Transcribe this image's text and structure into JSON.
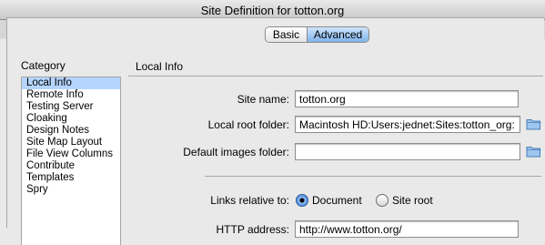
{
  "window": {
    "title": "Site Definition for totton.org"
  },
  "tabs": {
    "basic": "Basic",
    "advanced": "Advanced",
    "selected": "Advanced"
  },
  "sidebar": {
    "label": "Category",
    "selected": "Local Info",
    "items": [
      "Local Info",
      "Remote Info",
      "Testing Server",
      "Cloaking",
      "Design Notes",
      "Site Map Layout",
      "File View Columns",
      "Contribute",
      "Templates",
      "Spry"
    ]
  },
  "panel": {
    "title": "Local Info",
    "site_name": {
      "label": "Site name:",
      "value": "totton.org"
    },
    "local_root": {
      "label": "Local root folder:",
      "value": "Macintosh HD:Users:jednet:Sites:totton_org:"
    },
    "default_images": {
      "label": "Default images folder:",
      "value": ""
    },
    "links_relative": {
      "label": "Links relative to:",
      "option_document": "Document",
      "option_site_root": "Site root",
      "selected": "Document"
    },
    "http_address": {
      "label": "HTTP address:",
      "value": "http://www.totton.org/"
    }
  }
}
